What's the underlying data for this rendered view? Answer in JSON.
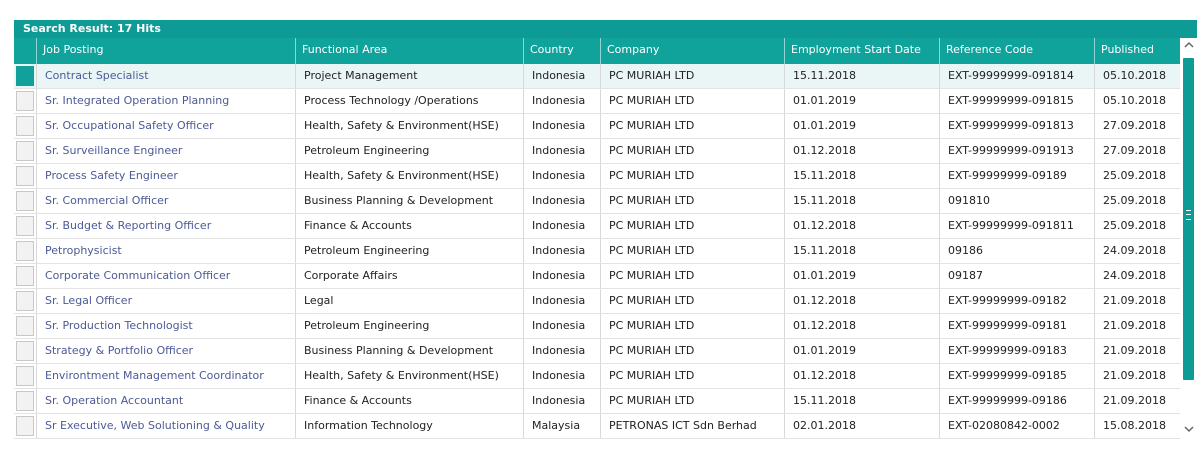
{
  "search_result": {
    "title": "Search Result: 17 Hits"
  },
  "columns": [
    "Job Posting",
    "Functional Area",
    "Country",
    "Company",
    "Employment Start Date",
    "Reference Code",
    "Published"
  ],
  "rows": [
    [
      "Contract Specialist",
      "Project Management",
      "Indonesia",
      "PC MURIAH LTD",
      "15.11.2018",
      "EXT-99999999-091814",
      "05.10.2018"
    ],
    [
      "Sr. Integrated Operation Planning",
      "Process Technology /Operations",
      "Indonesia",
      "PC MURIAH LTD",
      "01.01.2019",
      "EXT-99999999-091815",
      "05.10.2018"
    ],
    [
      "Sr. Occupational Safety Officer",
      "Health, Safety & Environment(HSE)",
      "Indonesia",
      "PC MURIAH LTD",
      "01.01.2019",
      "EXT-99999999-091813",
      "27.09.2018"
    ],
    [
      "Sr. Surveillance Engineer",
      "Petroleum Engineering",
      "Indonesia",
      "PC MURIAH LTD",
      "01.12.2018",
      "EXT-99999999-091913",
      "27.09.2018"
    ],
    [
      "Process Safety Engineer",
      "Health, Safety & Environment(HSE)",
      "Indonesia",
      "PC MURIAH LTD",
      "15.11.2018",
      "EXT-99999999-09189",
      "25.09.2018"
    ],
    [
      "Sr. Commercial Officer",
      "Business Planning & Development",
      "Indonesia",
      "PC MURIAH LTD",
      "15.11.2018",
      "091810",
      "25.09.2018"
    ],
    [
      "Sr. Budget & Reporting Officer",
      "Finance & Accounts",
      "Indonesia",
      "PC MURIAH LTD",
      "01.12.2018",
      "EXT-99999999-091811",
      "25.09.2018"
    ],
    [
      "Petrophysicist",
      "Petroleum Engineering",
      "Indonesia",
      "PC MURIAH LTD",
      "15.11.2018",
      "09186",
      "24.09.2018"
    ],
    [
      "Corporate Communication Officer",
      "Corporate Affairs",
      "Indonesia",
      "PC MURIAH LTD",
      "01.01.2019",
      "09187",
      "24.09.2018"
    ],
    [
      "Sr. Legal Officer",
      "Legal",
      "Indonesia",
      "PC MURIAH LTD",
      "01.12.2018",
      "EXT-99999999-09182",
      "21.09.2018"
    ],
    [
      "Sr. Production Technologist",
      "Petroleum Engineering",
      "Indonesia",
      "PC MURIAH LTD",
      "01.12.2018",
      "EXT-99999999-09181",
      "21.09.2018"
    ],
    [
      "Strategy & Portfolio Officer",
      "Business Planning & Development",
      "Indonesia",
      "PC MURIAH LTD",
      "01.01.2019",
      "EXT-99999999-09183",
      "21.09.2018"
    ],
    [
      "Environtment Management Coordinator",
      "Health, Safety & Environment(HSE)",
      "Indonesia",
      "PC MURIAH LTD",
      "01.12.2018",
      "EXT-99999999-09185",
      "21.09.2018"
    ],
    [
      "Sr. Operation Accountant",
      "Finance & Accounts",
      "Indonesia",
      "PC MURIAH LTD",
      "15.11.2018",
      "EXT-99999999-09186",
      "21.09.2018"
    ],
    [
      "Sr Executive, Web Solutioning & Quality",
      "Information Technology",
      "Malaysia",
      "PETRONAS ICT Sdn Berhad",
      "02.01.2018",
      "EXT-02080842-0002",
      "15.08.2018"
    ]
  ],
  "selected_row": 0,
  "colors": {
    "accent": "#0e9b95",
    "header": "#10a39c",
    "link": "#4c5a96",
    "selected_row": "#eaf6f6"
  },
  "icons": {
    "scroll_up": "chevron-up-icon",
    "scroll_down": "chevron-down-icon"
  }
}
